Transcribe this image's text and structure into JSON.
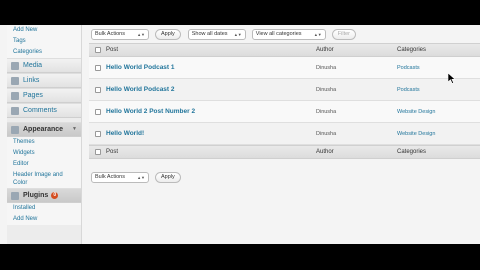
{
  "sidebar": {
    "posts_submenu": [
      "Add New",
      "Tags",
      "Categories"
    ],
    "menu": [
      {
        "label": "Media"
      },
      {
        "label": "Links"
      },
      {
        "label": "Pages"
      },
      {
        "label": "Comments"
      }
    ],
    "appearance": {
      "label": "Appearance",
      "submenu": [
        "Themes",
        "Widgets",
        "Editor",
        "Header Image and Color"
      ]
    },
    "plugins": {
      "label": "Plugins",
      "badge": "0",
      "submenu": [
        "Installed",
        "Add New"
      ]
    }
  },
  "toolbar_top": {
    "bulk_actions": "Bulk Actions",
    "apply": "Apply",
    "dates": "Show all dates",
    "categories": "View all categories",
    "filter": "Filter"
  },
  "toolbar_bottom": {
    "bulk_actions": "Bulk Actions",
    "apply": "Apply"
  },
  "table": {
    "headers": {
      "post": "Post",
      "author": "Author",
      "categories": "Categories"
    },
    "rows": [
      {
        "title": "Hello World Podcast 1",
        "author": "Dinusha",
        "category": "Podcasts"
      },
      {
        "title": "Hello World Podcast 2",
        "author": "Dinusha",
        "category": "Podcasts"
      },
      {
        "title": "Hello World 2 Post Number 2",
        "author": "Dinusha",
        "category": "Website Design"
      },
      {
        "title": "Hello World!",
        "author": "Dinusha",
        "category": "Website Design"
      }
    ]
  }
}
